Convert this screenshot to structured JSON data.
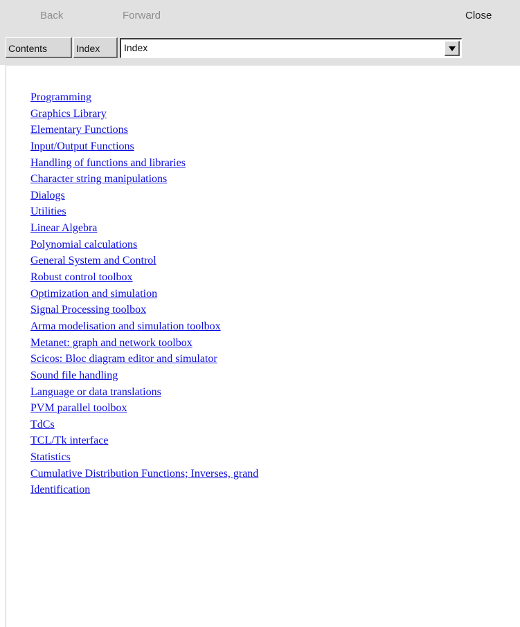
{
  "toolbar": {
    "back_label": "Back",
    "forward_label": "Forward",
    "close_label": "Close"
  },
  "tabs": {
    "contents_label": "Contents",
    "index_label": "Index"
  },
  "combo": {
    "selected_value": "Index"
  },
  "topics": [
    "Programming",
    "Graphics Library",
    "Elementary Functions",
    "Input/Output Functions",
    "Handling of functions and libraries",
    "Character string manipulations",
    "Dialogs",
    "Utilities",
    "Linear Algebra",
    "Polynomial calculations",
    "General System and Control",
    "Robust control toolbox",
    "Optimization and simulation",
    "Signal Processing toolbox",
    "Arma modelisation and simulation toolbox",
    "Metanet: graph and network toolbox",
    "Scicos: Bloc diagram editor and simulator",
    "Sound file handling",
    "Language or data translations",
    "PVM parallel toolbox",
    "TdCs",
    "TCL/Tk interface",
    "Statistics",
    "Cumulative Distribution Functions; Inverses, grand",
    "Identification"
  ],
  "colors": {
    "link": "#0d0ddf",
    "toolbar_bg": "#e1e1e1",
    "disabled_text": "#8e8e8e"
  }
}
